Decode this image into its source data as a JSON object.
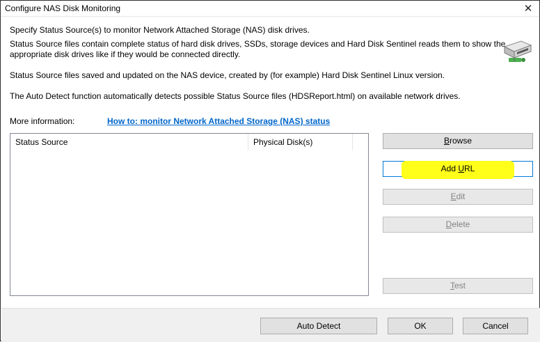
{
  "window": {
    "title": "Configure NAS Disk Monitoring",
    "close_glyph": "✕"
  },
  "description": {
    "line1": "Specify Status Source(s) to monitor Network Attached Storage (NAS) disk drives.",
    "line2": "Status Source files contain complete status of hard disk drives, SSDs, storage devices and Hard Disk Sentinel reads them to show the",
    "line3": "appropriate disk drives like if they would be connected directly.",
    "line4": "Status Source files saved and updated on the NAS device, created by (for example) Hard Disk Sentinel Linux version.",
    "line5": "The Auto Detect function automatically detects possible Status Source files (HDSReport.html) on available network drives."
  },
  "more_info": {
    "label": "More information:",
    "link": "How to: monitor Network Attached Storage (NAS) status"
  },
  "list": {
    "columns": [
      "Status Source",
      "Physical Disk(s)"
    ],
    "rows": []
  },
  "side_buttons": {
    "browse_pre": "",
    "browse_key": "B",
    "browse_post": "rowse",
    "add_url_pre": "Add ",
    "add_url_key": "U",
    "add_url_post": "RL",
    "edit_pre": "",
    "edit_key": "E",
    "edit_post": "dit",
    "delete_pre": "",
    "delete_key": "D",
    "delete_post": "elete",
    "test_pre": "",
    "test_key": "T",
    "test_post": "est"
  },
  "footer_buttons": {
    "auto_detect": "Auto Detect",
    "ok": "OK",
    "cancel": "Cancel"
  },
  "icons": {
    "nas": "nas-disk-icon"
  },
  "colors": {
    "link": "#0066cc",
    "highlight": "#ffff1a",
    "primary_border": "#0078d7"
  }
}
